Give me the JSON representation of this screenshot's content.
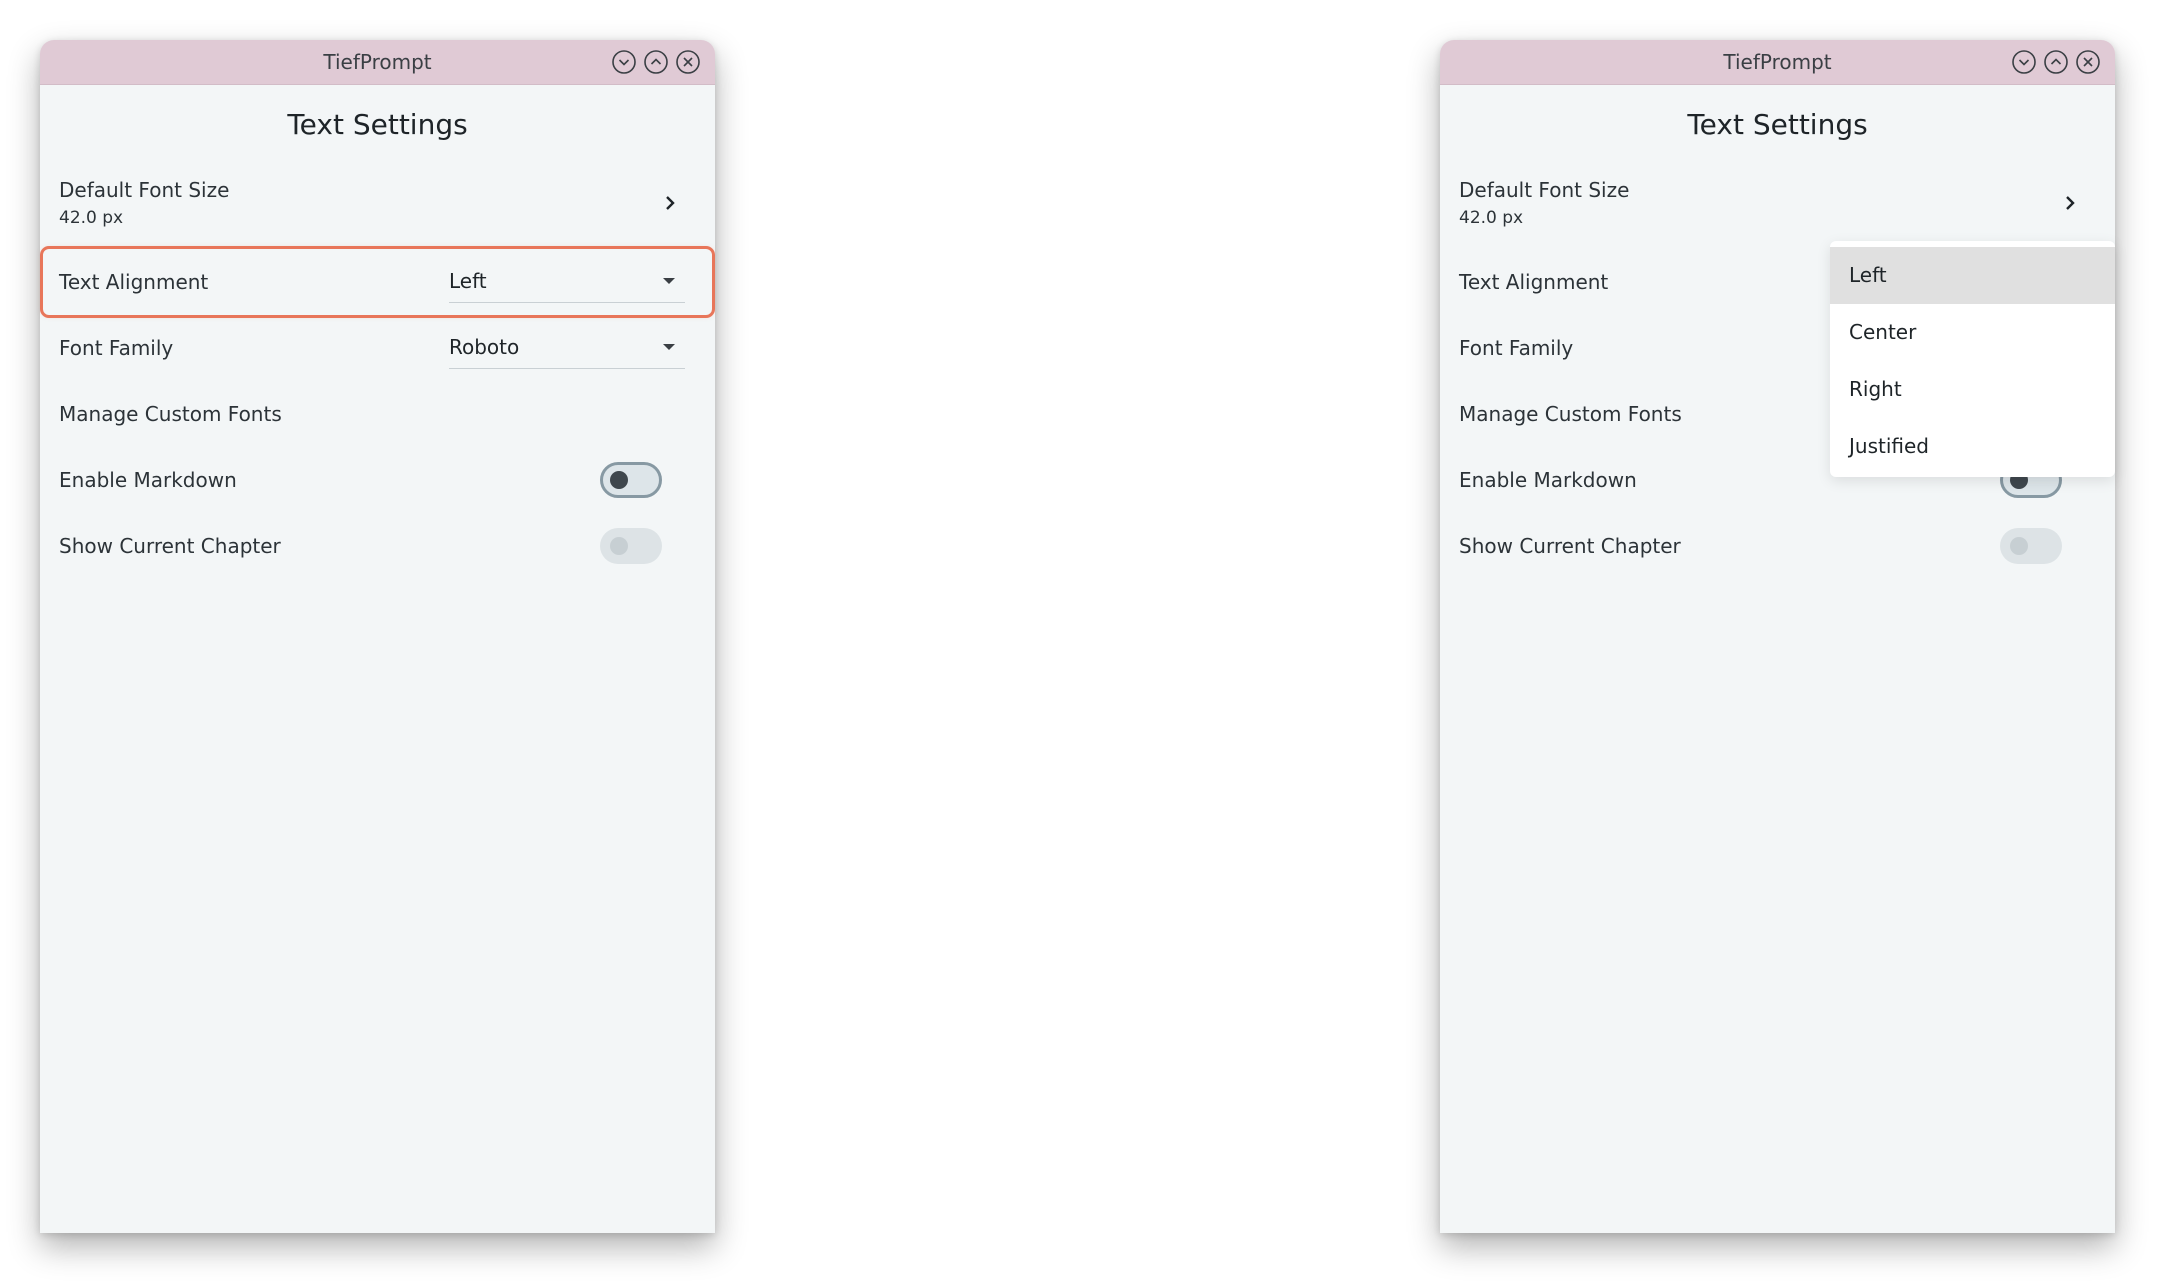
{
  "app": {
    "title": "TiefPrompt"
  },
  "window_controls": [
    "minimize-icon",
    "maximize-icon",
    "close-icon"
  ],
  "page": {
    "title": "Text Settings"
  },
  "settings": {
    "default_font_size": {
      "label": "Default Font Size",
      "value": "42.0 px"
    },
    "text_alignment": {
      "label": "Text Alignment",
      "value": "Left"
    },
    "font_family": {
      "label": "Font Family",
      "value": "Roboto"
    },
    "manage_custom_fonts": {
      "label": "Manage Custom Fonts"
    },
    "enable_markdown": {
      "label": "Enable Markdown",
      "enabled": false
    },
    "show_current_chapter": {
      "label": "Show Current Chapter",
      "enabled": false
    }
  },
  "alignment_dropdown": {
    "options": [
      "Left",
      "Center",
      "Right",
      "Justified"
    ],
    "selected": "Left"
  },
  "colors": {
    "titlebar": "#e0cad5",
    "background": "#f3f6f7",
    "highlight": "#e8765a",
    "dropdown_selected": "#e0e0e0"
  }
}
